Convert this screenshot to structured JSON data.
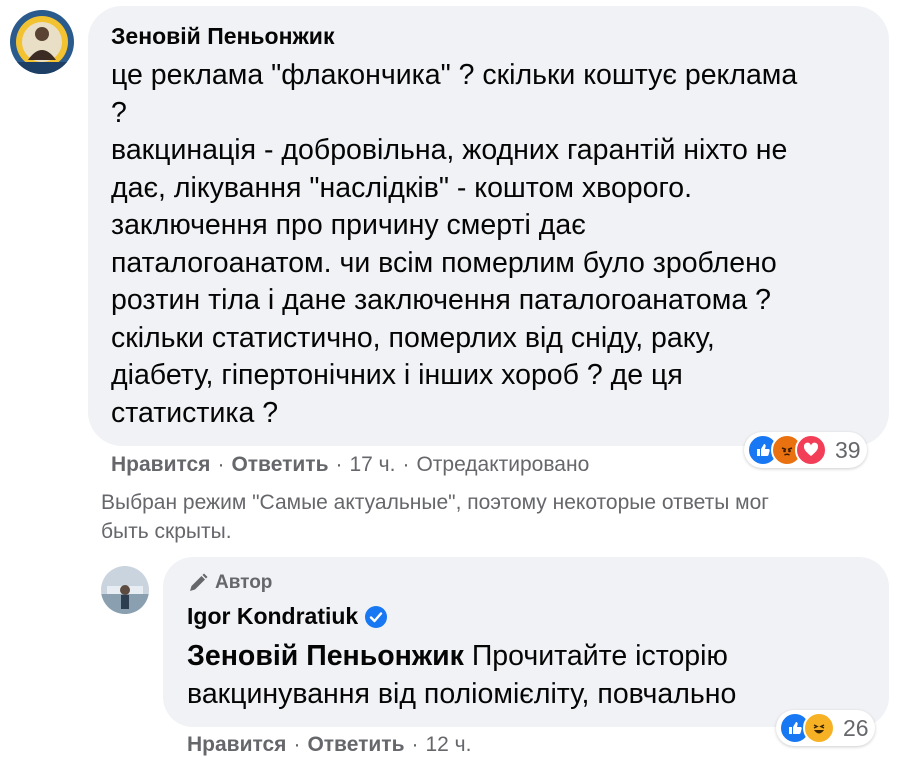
{
  "comment": {
    "author": "Зеновій Пеньонжик",
    "text_lines": [
      "це реклама \"флакончика\" ? скільки коштує реклама",
      "?",
      "вакцинація - добровільна, жодних гарантій ніхто не",
      "дає, лікування \"наслідків\" - коштом хворого.",
      "заключення про причину смерті дає",
      "паталогоанатом. чи всім померлим було зроблено",
      "розтин тіла і дане заключення паталогоанатома ?",
      "скільки статистично, померлих від сніду, раку,",
      "діабету, гіпертонічних і інших хороб ? де ця",
      "статистика ?"
    ],
    "like_label": "Нравится",
    "reply_label": "Ответить",
    "time": "17 ч.",
    "edited": "Отредактировано",
    "separator": "·",
    "reactions": {
      "icons": [
        "like-icon",
        "angry-icon",
        "love-icon"
      ],
      "count": "39"
    }
  },
  "notice": {
    "line1": "Выбран режим \"Самые актуальные\", поэтому некоторые ответы мог",
    "line2": "быть скрыты."
  },
  "reply": {
    "badge": "Автор",
    "author": "Igor Kondratiuk",
    "verified_icon": "verified-badge-icon",
    "mention": "Зеновій Пеньонжик",
    "text_line1": "Прочитайте історію",
    "text_line2": "вакцинування від поліомієліту, повчально",
    "like_label": "Нравится",
    "reply_label": "Ответить",
    "time": "12 ч.",
    "separator": "·",
    "reactions": {
      "icons": [
        "like-icon",
        "haha-icon"
      ],
      "count": "26"
    }
  },
  "colors": {
    "bubble": "#f0f2f5",
    "secondary_text": "#65676b",
    "like_blue": "#1877f2",
    "love_red": "#f33e58",
    "angry_orange": "#e9710f",
    "haha_yellow": "#f7b125"
  }
}
